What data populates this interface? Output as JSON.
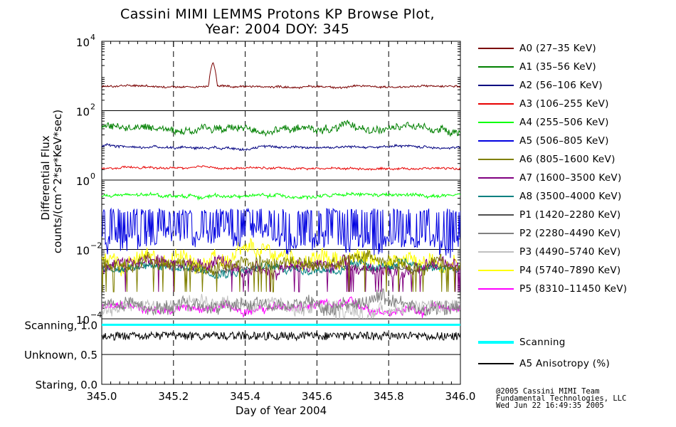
{
  "title_line1": "Cassini MIMI LEMMS Protons KP Browse Plot,",
  "title_line2": "Year: 2004 DOY: 345",
  "credits": [
    "@2005 Cassini MIMI Team",
    "Fundamental Technologies, LLC",
    "Wed Jun 22 16:49:35 2005"
  ],
  "chart_data": {
    "type": "line",
    "xlabel": "Day of Year 2004",
    "ylabel_line1": "Differential Flux",
    "ylabel_line2": "counts/(cm^2*sr*KeV*sec)",
    "xlim": [
      345.0,
      346.0
    ],
    "x_ticks": [
      "345.0",
      "345.2",
      "345.4",
      "345.6",
      "345.8",
      "346.0"
    ],
    "x_tick_values": [
      345.0,
      345.2,
      345.4,
      345.6,
      345.8,
      346.0
    ],
    "y_scale": "log",
    "ylim": [
      0.0001,
      10000
    ],
    "y_ticks": [
      {
        "value": 10000,
        "base": "10",
        "exp": "4"
      },
      {
        "value": 100,
        "base": "10",
        "exp": "2"
      },
      {
        "value": 1,
        "base": "10",
        "exp": "0"
      },
      {
        "value": 0.01,
        "base": "10",
        "exp": "−2"
      },
      {
        "value": 0.0001,
        "base": "10",
        "exp": "−4"
      }
    ],
    "lower_panel": {
      "y_labels": [
        {
          "text": "Scanning, 1.0",
          "value": 1.0
        },
        {
          "text": "Unknown, 0.5",
          "value": 0.5
        },
        {
          "text": "Staring, 0.0",
          "value": 0.0
        }
      ]
    },
    "series": [
      {
        "name": "A0 (27–35 KeV)",
        "color": "#7a0000",
        "level": 500,
        "noise": 0.05,
        "spike_x": 345.31,
        "spike_peak": 2500
      },
      {
        "name": "A1 (35–56 KeV)",
        "color": "#008000",
        "level": 30,
        "noise": 0.18
      },
      {
        "name": "A2 (56–106 KeV)",
        "color": "#000080",
        "level": 9,
        "noise": 0.06
      },
      {
        "name": "A3 (106–255 KeV)",
        "color": "#e80000",
        "level": 2.2,
        "noise": 0.05
      },
      {
        "name": "A4 (255–506 KeV)",
        "color": "#00ff00",
        "level": 0.35,
        "noise": 0.08
      },
      {
        "name": "A5 (506–805 KeV)",
        "color": "#0000e0",
        "level": 0.02,
        "noise": 0.5
      },
      {
        "name": "A6 (805–1600 KeV)",
        "color": "#808000",
        "level": 0.004,
        "noise": 0.3
      },
      {
        "name": "A7 (1600–3500 KeV)",
        "color": "#800080",
        "level": 0.003,
        "noise": 0.3
      },
      {
        "name": "A8 (3500–4000 KeV)",
        "color": "#008080",
        "level": 0.003,
        "noise": 0.2
      },
      {
        "name": "P1 (1420–2280 KeV)",
        "color": "#505050",
        "level": 0.003,
        "noise": 0.12
      },
      {
        "name": "P2 (2280–4490 KeV)",
        "color": "#808080",
        "level": 0.0003,
        "noise": 0.3
      },
      {
        "name": "P3 (4490–5740 KeV)",
        "color": "#c0c0c0",
        "level": 0.0002,
        "noise": 0.3
      },
      {
        "name": "P4 (5740–7890 KeV)",
        "color": "#ffff00",
        "level": 0.005,
        "noise": 0.4
      },
      {
        "name": "P5 (8310–11450 KeV)",
        "color": "#ff00ff",
        "level": 0.0002,
        "noise": 0.2
      }
    ],
    "scanning_series": {
      "name": "Scanning",
      "color": "#00ffff",
      "value": 1.0
    },
    "anisotropy_series": {
      "name": "A5 Anisotropy (%)",
      "color": "#000000"
    }
  }
}
